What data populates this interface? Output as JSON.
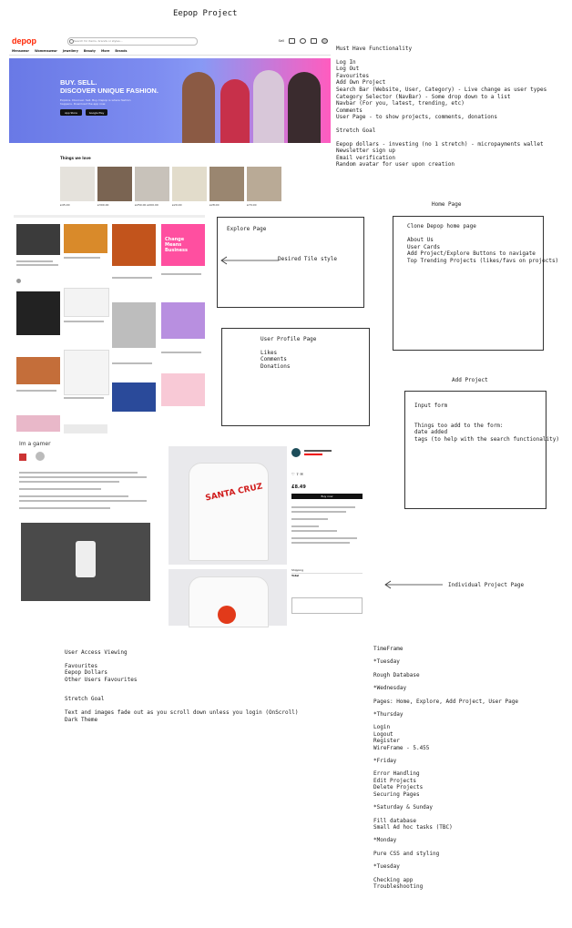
{
  "title": "Eepop Project",
  "site": {
    "logo": "depop",
    "search_placeholder": "Search for items, brands or styles...",
    "nav_right": {
      "sell": "Sell"
    },
    "categories": [
      "Menswear",
      "Womenswear",
      "Jewellery",
      "Beauty",
      "More",
      "Brands"
    ],
    "hero_line1": "BUY. SELL.",
    "hero_line2": "DISCOVER UNIQUE FASHION.",
    "hero_sub": "Explore. Discover. Sell. Buy. Depop is where fashion happens. Download the app now.",
    "app_store": "App Store",
    "google_play": "Google Play",
    "things_heading": "Things we love",
    "prices": [
      "£45.00",
      "£300.00",
      "£250.00 £200.00",
      "£20.00",
      "£28.00",
      "£70.00"
    ],
    "colors": {
      "brand": "#ff2300",
      "hero_left": "#6979e6",
      "hero_right": "#ff5cbf"
    }
  },
  "explore_mock": {
    "feature_title": "Change Means Business",
    "label_arrow": "Desired Tile style"
  },
  "project_mock": {
    "heading": "Im a gamer",
    "price": "£8.49",
    "buy_button": "Buy now",
    "shirt_text": "SANTA CRUZ",
    "shipping": "Shipping",
    "total_label": "Total",
    "label_arrow": "Individual Project Page"
  },
  "must_have": {
    "heading": "Must Have Functionality",
    "items": [
      "Log In",
      "Log Out",
      "Favourites",
      "Add Own Project",
      "Search Bar (Website, User, Category) - Live change as user types",
      "Category Selector (NavBar) - Some drop down to a list",
      "Navbar (For you, latest, trending, etc)",
      "Comments",
      "User Page - to show projects, comments, donations"
    ],
    "stretch_heading": "Stretch Goal",
    "stretch_items": [
      "Eepop dollars - investing (no 1 stretch) - micropayments wallet",
      "Newsletter sign up",
      "Email verification",
      "Random avatar for user upon creation"
    ]
  },
  "home_page": {
    "label": "Home Page",
    "items": [
      "Clone Depop home page",
      "",
      "About Us",
      "User Cards",
      "Add Project/Explore Buttons to navigate",
      "Top Trending Projects (likes/favs on projects)"
    ]
  },
  "explore_page": {
    "title": "Explore Page"
  },
  "user_profile": {
    "title": "User Profile Page",
    "items": [
      "Likes",
      "Comments",
      "Donations"
    ]
  },
  "add_project": {
    "label": "Add Project",
    "title": "Input form",
    "items": [
      "Things too add to the form:",
      "date added",
      "tags (to help with the search functionality)"
    ]
  },
  "user_access": {
    "heading": "User Access Viewing",
    "items": [
      "Favourites",
      "Eepop Dollars",
      "Other Users Favourites"
    ],
    "stretch_heading": "Stretch Goal",
    "stretch_items": [
      "Text and images fade out as you scroll down unless you login (OnScroll)",
      "Dark Theme"
    ]
  },
  "timeframe": {
    "heading": "TimeFrame",
    "entries": [
      "*Tuesday",
      "Rough Database",
      "*Wednesday",
      "Pages: Home, Explore, Add Project, User Page",
      "*Thursday",
      "Login",
      "Logout",
      "Register",
      "WireFrame - 5.455",
      "*Friday",
      "Error Handling",
      "Edit Projects",
      "Delete Projects",
      "Securing Pages",
      "*Saturday & Sunday",
      "Fill database",
      "Small Ad hoc tasks (TBC)",
      "*Monday",
      "Pure CSS and styling",
      "*Tuesday",
      "Checking app",
      "Troubleshooting"
    ]
  }
}
